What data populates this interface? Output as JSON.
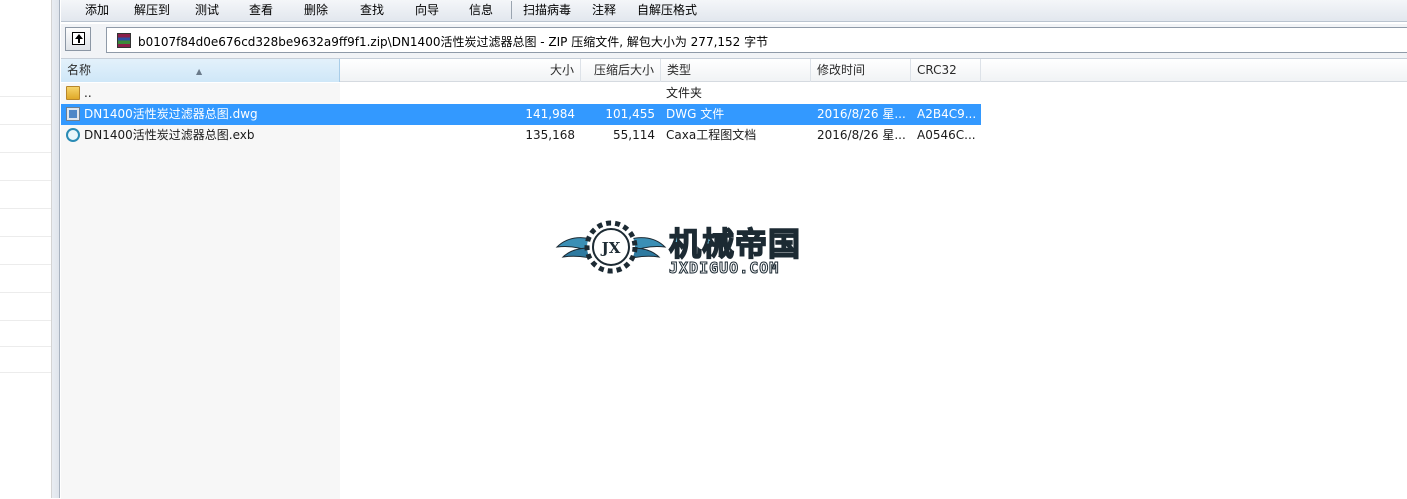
{
  "toolbar": {
    "items": [
      "添加",
      "解压到",
      "测试",
      "查看",
      "删除",
      "查找",
      "向导",
      "信息",
      "扫描病毒",
      "注释",
      "自解压格式"
    ]
  },
  "address": {
    "path": "b0107f84d0e676cd328be9632a9ff9f1.zip\\DN1400活性炭过滤器总图 - ZIP 压缩文件, 解包大小为 277,152 字节"
  },
  "columns": {
    "name": "名称",
    "size": "大小",
    "packed": "压缩后大小",
    "type": "类型",
    "modified": "修改时间",
    "crc": "CRC32"
  },
  "rows": [
    {
      "name": "..",
      "size": "",
      "packed": "",
      "type": "文件夹",
      "modified": "",
      "crc": "",
      "icon": "folder-icon"
    },
    {
      "name": "DN1400活性炭过滤器总图.dwg",
      "size": "141,984",
      "packed": "101,455",
      "type": "DWG 文件",
      "modified": "2016/8/26 星...",
      "crc": "A2B4C9...",
      "icon": "dwg-file-icon",
      "selected": true
    },
    {
      "name": "DN1400活性炭过滤器总图.exb",
      "size": "135,168",
      "packed": "55,114",
      "type": "Caxa工程图文档",
      "modified": "2016/8/26 星...",
      "crc": "A0546C...",
      "icon": "exb-file-icon"
    }
  ],
  "watermark": {
    "title": "机械帝国",
    "subtitle": "JXDIGUO.COM",
    "badge": "JX"
  },
  "colors": {
    "selection": "#3399ff",
    "logo_blue": "#3b8fb5",
    "logo_dark": "#1c2a33"
  }
}
